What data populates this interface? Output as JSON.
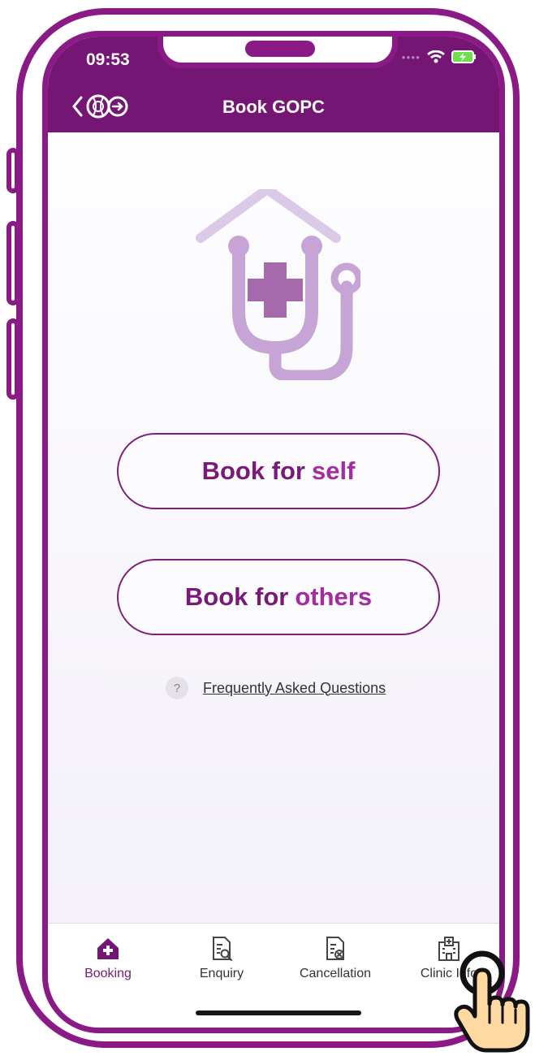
{
  "status_bar": {
    "time": "09:53"
  },
  "header": {
    "title": "Book GOPC"
  },
  "actions": {
    "self": {
      "prefix": "Book for",
      "emphasis": "self"
    },
    "others": {
      "prefix": "Book for",
      "emphasis": "others"
    }
  },
  "faq": {
    "icon_text": "?",
    "label": "Frequently Asked Questions"
  },
  "tabs": [
    {
      "label": "Booking",
      "icon": "home-plus-icon",
      "active": true
    },
    {
      "label": "Enquiry",
      "icon": "document-search-icon"
    },
    {
      "label": "Cancellation",
      "icon": "document-cancel-icon"
    },
    {
      "label": "Clinic Info",
      "icon": "hospital-icon"
    }
  ],
  "theme": {
    "primary": "#761674",
    "accent": "#a22ca0",
    "frame": "#8a1a86",
    "hero_tint": "#c6a5d6"
  }
}
